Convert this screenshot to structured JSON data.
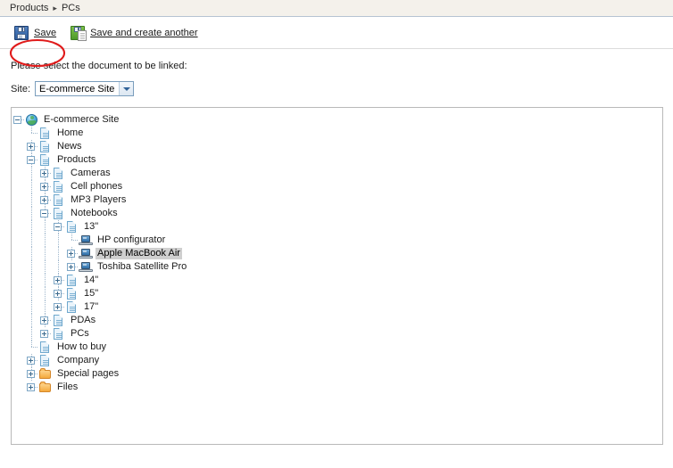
{
  "breadcrumb": {
    "items": [
      "Products",
      "PCs"
    ],
    "separator": "▸"
  },
  "toolbar": {
    "save_label": "Save",
    "save_icon": "floppy-disk-icon",
    "save_and_create_label": "Save and create another",
    "save_and_create_icon": "floppy-disk-new-page-icon",
    "annotation": {
      "shape": "ellipse",
      "color": "#e01b1b",
      "target": "save-button"
    }
  },
  "instruction": "Please select the document to be linked:",
  "site_selector": {
    "label": "Site:",
    "value": "E-commerce Site",
    "options": [
      "E-commerce Site"
    ],
    "arrow_icon": "chevron-down-icon"
  },
  "tree": {
    "nodes": [
      {
        "label": "E-commerce Site",
        "depth": 0,
        "icon": "globe-icon",
        "expander": "minus",
        "selected": false
      },
      {
        "label": "Home",
        "depth": 1,
        "icon": "document-icon",
        "expander": "none",
        "selected": false
      },
      {
        "label": "News",
        "depth": 1,
        "icon": "document-icon",
        "expander": "plus",
        "selected": false
      },
      {
        "label": "Products",
        "depth": 1,
        "icon": "document-icon",
        "expander": "minus",
        "selected": false
      },
      {
        "label": "Cameras",
        "depth": 2,
        "icon": "document-icon",
        "expander": "plus",
        "selected": false
      },
      {
        "label": "Cell phones",
        "depth": 2,
        "icon": "document-icon",
        "expander": "plus",
        "selected": false
      },
      {
        "label": "MP3 Players",
        "depth": 2,
        "icon": "document-icon",
        "expander": "plus",
        "selected": false
      },
      {
        "label": "Notebooks",
        "depth": 2,
        "icon": "document-icon",
        "expander": "minus",
        "selected": false
      },
      {
        "label": "13\"",
        "depth": 3,
        "icon": "document-icon",
        "expander": "minus",
        "selected": false
      },
      {
        "label": "HP configurator",
        "depth": 4,
        "icon": "laptop-icon",
        "expander": "none",
        "selected": false
      },
      {
        "label": "Apple MacBook Air",
        "depth": 4,
        "icon": "laptop-icon",
        "expander": "plus",
        "selected": true
      },
      {
        "label": "Toshiba Satellite Pro",
        "depth": 4,
        "icon": "laptop-icon",
        "expander": "plus",
        "selected": false
      },
      {
        "label": "14\"",
        "depth": 3,
        "icon": "document-icon",
        "expander": "plus",
        "selected": false
      },
      {
        "label": "15\"",
        "depth": 3,
        "icon": "document-icon",
        "expander": "plus",
        "selected": false
      },
      {
        "label": "17\"",
        "depth": 3,
        "icon": "document-icon",
        "expander": "plus",
        "selected": false
      },
      {
        "label": "PDAs",
        "depth": 2,
        "icon": "document-icon",
        "expander": "plus",
        "selected": false
      },
      {
        "label": "PCs",
        "depth": 2,
        "icon": "document-icon",
        "expander": "plus",
        "selected": false
      },
      {
        "label": "How to buy",
        "depth": 1,
        "icon": "document-icon",
        "expander": "none",
        "selected": false
      },
      {
        "label": "Company",
        "depth": 1,
        "icon": "document-icon",
        "expander": "plus",
        "selected": false
      },
      {
        "label": "Special pages",
        "depth": 1,
        "icon": "folder-icon",
        "expander": "plus",
        "selected": false
      },
      {
        "label": "Files",
        "depth": 1,
        "icon": "folder-icon",
        "expander": "plus",
        "selected": false
      }
    ]
  },
  "colors": {
    "breadcrumb_bg": "#f4f1eb",
    "breadcrumb_border": "#b6c3d2",
    "panel_border": "#b9b9b9",
    "selection_bg": "#cfcfcf",
    "annotation_red": "#e01b1b",
    "folder_orange": "#f5a93c",
    "link_text": "#1b1b1b"
  }
}
